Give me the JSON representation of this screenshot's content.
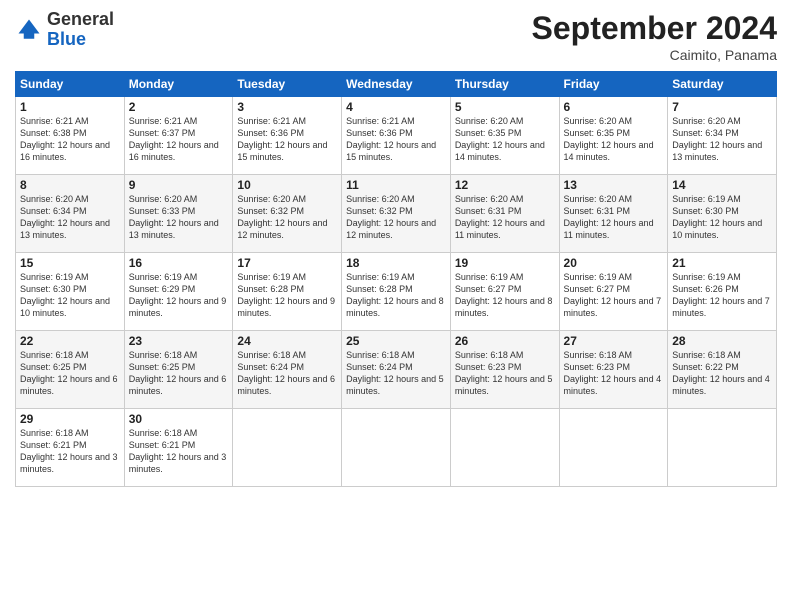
{
  "header": {
    "logo_general": "General",
    "logo_blue": "Blue",
    "month_title": "September 2024",
    "location": "Caimito, Panama"
  },
  "days_of_week": [
    "Sunday",
    "Monday",
    "Tuesday",
    "Wednesday",
    "Thursday",
    "Friday",
    "Saturday"
  ],
  "weeks": [
    [
      {
        "day": "1",
        "sunrise": "6:21 AM",
        "sunset": "6:38 PM",
        "daylight": "12 hours and 16 minutes."
      },
      {
        "day": "2",
        "sunrise": "6:21 AM",
        "sunset": "6:37 PM",
        "daylight": "12 hours and 16 minutes."
      },
      {
        "day": "3",
        "sunrise": "6:21 AM",
        "sunset": "6:36 PM",
        "daylight": "12 hours and 15 minutes."
      },
      {
        "day": "4",
        "sunrise": "6:21 AM",
        "sunset": "6:36 PM",
        "daylight": "12 hours and 15 minutes."
      },
      {
        "day": "5",
        "sunrise": "6:20 AM",
        "sunset": "6:35 PM",
        "daylight": "12 hours and 14 minutes."
      },
      {
        "day": "6",
        "sunrise": "6:20 AM",
        "sunset": "6:35 PM",
        "daylight": "12 hours and 14 minutes."
      },
      {
        "day": "7",
        "sunrise": "6:20 AM",
        "sunset": "6:34 PM",
        "daylight": "12 hours and 13 minutes."
      }
    ],
    [
      {
        "day": "8",
        "sunrise": "6:20 AM",
        "sunset": "6:34 PM",
        "daylight": "12 hours and 13 minutes."
      },
      {
        "day": "9",
        "sunrise": "6:20 AM",
        "sunset": "6:33 PM",
        "daylight": "12 hours and 13 minutes."
      },
      {
        "day": "10",
        "sunrise": "6:20 AM",
        "sunset": "6:32 PM",
        "daylight": "12 hours and 12 minutes."
      },
      {
        "day": "11",
        "sunrise": "6:20 AM",
        "sunset": "6:32 PM",
        "daylight": "12 hours and 12 minutes."
      },
      {
        "day": "12",
        "sunrise": "6:20 AM",
        "sunset": "6:31 PM",
        "daylight": "12 hours and 11 minutes."
      },
      {
        "day": "13",
        "sunrise": "6:20 AM",
        "sunset": "6:31 PM",
        "daylight": "12 hours and 11 minutes."
      },
      {
        "day": "14",
        "sunrise": "6:19 AM",
        "sunset": "6:30 PM",
        "daylight": "12 hours and 10 minutes."
      }
    ],
    [
      {
        "day": "15",
        "sunrise": "6:19 AM",
        "sunset": "6:30 PM",
        "daylight": "12 hours and 10 minutes."
      },
      {
        "day": "16",
        "sunrise": "6:19 AM",
        "sunset": "6:29 PM",
        "daylight": "12 hours and 9 minutes."
      },
      {
        "day": "17",
        "sunrise": "6:19 AM",
        "sunset": "6:28 PM",
        "daylight": "12 hours and 9 minutes."
      },
      {
        "day": "18",
        "sunrise": "6:19 AM",
        "sunset": "6:28 PM",
        "daylight": "12 hours and 8 minutes."
      },
      {
        "day": "19",
        "sunrise": "6:19 AM",
        "sunset": "6:27 PM",
        "daylight": "12 hours and 8 minutes."
      },
      {
        "day": "20",
        "sunrise": "6:19 AM",
        "sunset": "6:27 PM",
        "daylight": "12 hours and 7 minutes."
      },
      {
        "day": "21",
        "sunrise": "6:19 AM",
        "sunset": "6:26 PM",
        "daylight": "12 hours and 7 minutes."
      }
    ],
    [
      {
        "day": "22",
        "sunrise": "6:18 AM",
        "sunset": "6:25 PM",
        "daylight": "12 hours and 6 minutes."
      },
      {
        "day": "23",
        "sunrise": "6:18 AM",
        "sunset": "6:25 PM",
        "daylight": "12 hours and 6 minutes."
      },
      {
        "day": "24",
        "sunrise": "6:18 AM",
        "sunset": "6:24 PM",
        "daylight": "12 hours and 6 minutes."
      },
      {
        "day": "25",
        "sunrise": "6:18 AM",
        "sunset": "6:24 PM",
        "daylight": "12 hours and 5 minutes."
      },
      {
        "day": "26",
        "sunrise": "6:18 AM",
        "sunset": "6:23 PM",
        "daylight": "12 hours and 5 minutes."
      },
      {
        "day": "27",
        "sunrise": "6:18 AM",
        "sunset": "6:23 PM",
        "daylight": "12 hours and 4 minutes."
      },
      {
        "day": "28",
        "sunrise": "6:18 AM",
        "sunset": "6:22 PM",
        "daylight": "12 hours and 4 minutes."
      }
    ],
    [
      {
        "day": "29",
        "sunrise": "6:18 AM",
        "sunset": "6:21 PM",
        "daylight": "12 hours and 3 minutes."
      },
      {
        "day": "30",
        "sunrise": "6:18 AM",
        "sunset": "6:21 PM",
        "daylight": "12 hours and 3 minutes."
      },
      null,
      null,
      null,
      null,
      null
    ]
  ]
}
